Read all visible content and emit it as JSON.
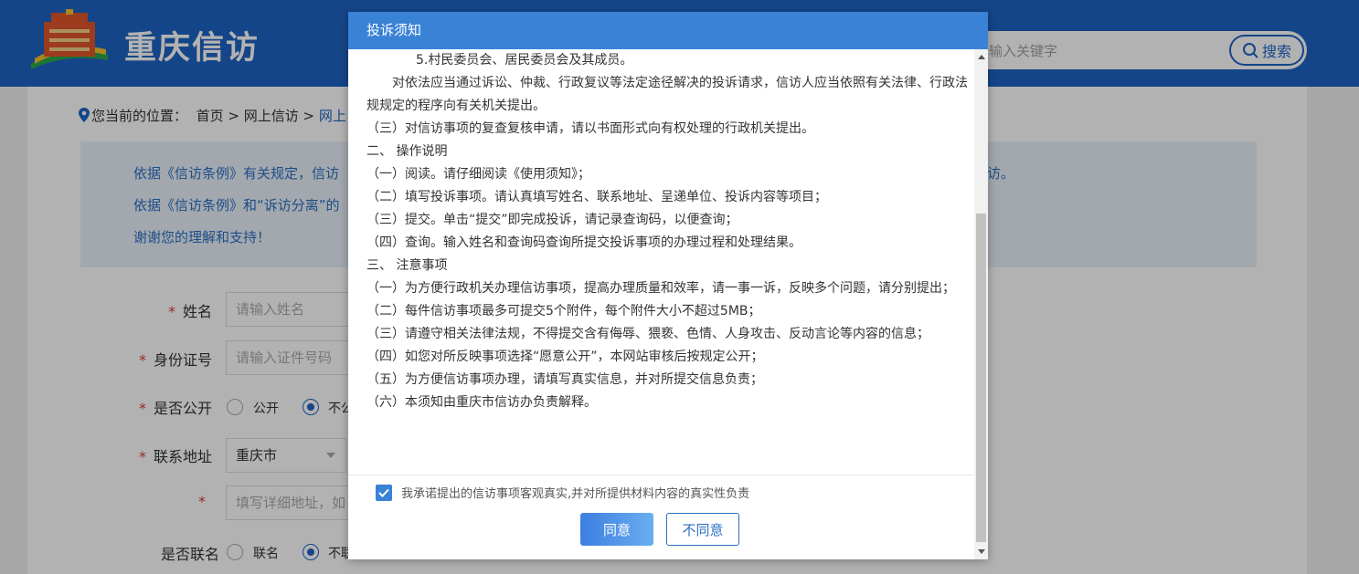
{
  "header": {
    "site_title": "重庆信访",
    "search_placeholder": "输入关键字",
    "search_button": "搜索"
  },
  "breadcrumb": {
    "prefix": "您当前的位置：",
    "items": [
      "首页",
      "网上信访",
      "网上"
    ],
    "separator": " > "
  },
  "notice": {
    "line1": "依据《信访条例》有关规定，信访",
    "line2": "依据《信访条例》和“诉访分离”的",
    "line3": "谢谢您的理解和支持！",
    "line1_suffix": "访。"
  },
  "form": {
    "name_label": "姓名",
    "name_placeholder": "请输入姓名",
    "id_label": "身份证号",
    "id_placeholder": "请输入证件号码",
    "public_label": "是否公开",
    "public_option_yes": "公开",
    "public_option_no": "不公",
    "address_label": "联系地址",
    "address_city": "重庆市",
    "address_detail_placeholder": "填写详细地址，如",
    "contact_label": "是否联名",
    "contact_option_yes": "联名",
    "contact_option_no": "不联",
    "required_mark": "*"
  },
  "modal": {
    "title": "投诉须知",
    "paragraphs": [
      "5.村民委员会、居民委员会及其成员。",
      "对依法应当通过诉讼、仲裁、行政复议等法定途径解决的投诉请求，信访人应当依照有关法律、行政法规规定的程序向有关机关提出。",
      "（三）对信访事项的复查复核申请，请以书面形式向有权处理的行政机关提出。",
      "二、 操作说明",
      "（一）阅读。请仔细阅读《使用须知》；",
      "（二）填写投诉事项。请认真填写姓名、联系地址、呈递单位、投诉内容等项目；",
      "（三）提交。单击“提交”即完成投诉，请记录查询码，以便查询；",
      "（四）查询。输入姓名和查询码查询所提交投诉事项的办理过程和处理结果。",
      "三、 注意事项",
      "（一）为方便行政机关办理信访事项，提高办理质量和效率，请一事一诉，反映多个问题，请分别提出；",
      "（二）每件信访事项最多可提交5个附件，每个附件大小不超过5MB；",
      "（三）请遵守相关法律法规，不得提交含有侮辱、猥亵、色情、人身攻击、反动言论等内容的信息；",
      "（四）如您对所反映事项选择“愿意公开”，本网站审核后按规定公开；",
      "（五）为方便信访事项办理，请填写真实信息，并对所提交信息负责；",
      "（六）本须知由重庆市信访办负责解释。"
    ],
    "promise_text": "我承诺提出的信访事项客观真实,并对所提供材料内容的真实性负责",
    "agree_button": "同意",
    "disagree_button": "不同意"
  }
}
